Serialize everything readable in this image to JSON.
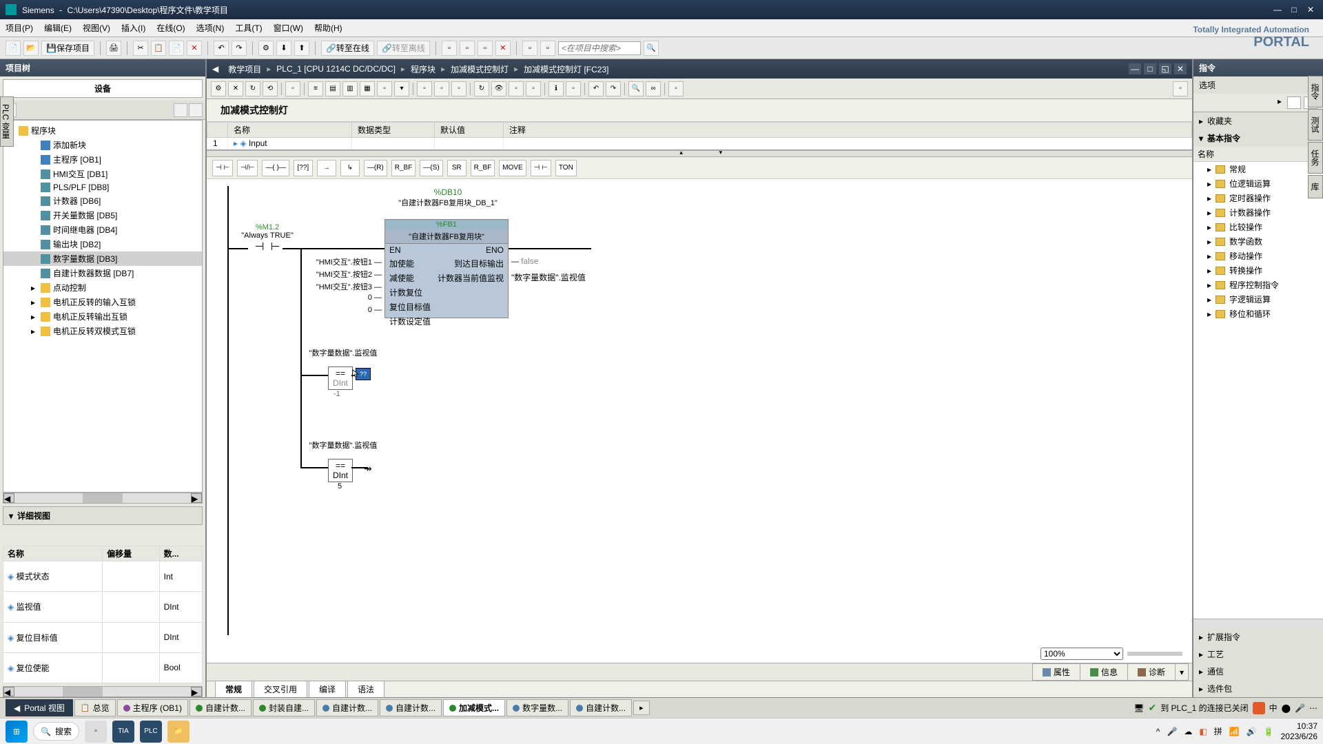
{
  "titlebar": {
    "app": "Siemens",
    "path": "C:\\Users\\47390\\Desktop\\程序文件\\教学项目"
  },
  "menu": [
    "项目(P)",
    "编辑(E)",
    "视图(V)",
    "插入(I)",
    "在线(O)",
    "选项(N)",
    "工具(T)",
    "窗口(W)",
    "帮助(H)"
  ],
  "brand": {
    "line1": "Totally Integrated Automation",
    "line2": "PORTAL"
  },
  "toolbar": {
    "save": "保存项目",
    "go_online": "转至在线",
    "go_offline": "转至离线",
    "search_placeholder": "<在项目中搜索>"
  },
  "breadcrumb": [
    "教学项目",
    "PLC_1 [CPU 1214C DC/DC/DC]",
    "程序块",
    "加减模式控制灯",
    "加减模式控制灯 [FC23]"
  ],
  "left": {
    "header": "项目树",
    "devices": "设备",
    "tree_root": "程序块",
    "tree": [
      {
        "label": "添加新块",
        "icon": "add"
      },
      {
        "label": "主程序 [OB1]",
        "icon": "ob"
      },
      {
        "label": "HMI交互 [DB1]",
        "icon": "db"
      },
      {
        "label": "PLS/PLF [DB8]",
        "icon": "db"
      },
      {
        "label": "计数器 [DB6]",
        "icon": "db"
      },
      {
        "label": "开关量数据 [DB5]",
        "icon": "db"
      },
      {
        "label": "时间继电器 [DB4]",
        "icon": "db"
      },
      {
        "label": "输出块 [DB2]",
        "icon": "db"
      },
      {
        "label": "数字量数据 [DB3]",
        "icon": "db",
        "selected": true
      },
      {
        "label": "自建计数器数据 [DB7]",
        "icon": "db"
      },
      {
        "label": "点动控制",
        "icon": "folder",
        "expandable": true
      },
      {
        "label": "电机正反转的输入互锁",
        "icon": "folder",
        "expandable": true
      },
      {
        "label": "电机正反转输出互锁",
        "icon": "folder",
        "expandable": true
      },
      {
        "label": "电机正反转双模式互锁",
        "icon": "folder",
        "expandable": true
      }
    ],
    "detail_header": "详细视图",
    "detail_cols": [
      "名称",
      "偏移量",
      "数..."
    ],
    "detail_rows": [
      {
        "name": "模式状态",
        "offset": "",
        "type": "Int"
      },
      {
        "name": "监视值",
        "offset": "",
        "type": "DInt"
      },
      {
        "name": "复位目标值",
        "offset": "",
        "type": "DInt"
      },
      {
        "name": "复位使能",
        "offset": "",
        "type": "Bool"
      }
    ]
  },
  "side_tab": "PLC 变量",
  "editor": {
    "block_title": "加减模式控制灯",
    "var_cols": [
      "",
      "名称",
      "数据类型",
      "默认值",
      "注释"
    ],
    "var_row_num": "1",
    "var_row_name": "Input",
    "lad_btns": [
      "⊣ ⊢",
      "⊣/⊢",
      "—( )—",
      "[??]",
      "→",
      "↳",
      "—(R)",
      "R_BF",
      "—(S)",
      "SR",
      "R_BF",
      "MOVE",
      "⊣ ⊢",
      "TON"
    ],
    "network": {
      "contact_tag": "%M1.2",
      "contact_name": "\"Always TRUE\"",
      "db_tag": "%DB10",
      "db_name": "\"自建计数器FB复用块_DB_1\"",
      "fb_tag": "%FB1",
      "fb_name": "\"自建计数器FB复用块\"",
      "fb_en": "EN",
      "fb_eno": "ENO",
      "fb_inputs": [
        {
          "src": "\"HMI交互\".按钮1",
          "pin": "加使能"
        },
        {
          "src": "\"HMI交互\".按钮2",
          "pin": "减使能"
        },
        {
          "src": "\"HMI交互\".按钮3",
          "pin": "计数复位"
        },
        {
          "src": "0",
          "pin": "复位目标值"
        },
        {
          "src": "0",
          "pin": "计数设定值"
        }
      ],
      "fb_outputs": [
        {
          "pin": "到达目标输出",
          "dst": "false"
        },
        {
          "pin": "计数器当前值监视",
          "dst": "\"数字量数据\".监视值"
        }
      ],
      "cmp1": {
        "src": "\"数字量数据\".监视值",
        "op": "==",
        "type": "DInt",
        "val": "-1"
      },
      "cmp2": {
        "src": "\"数字量数据\".监视值",
        "op": "==",
        "type": "DInt",
        "val": "5"
      }
    },
    "zoom": "100%"
  },
  "inspector_tabs": [
    "属性",
    "信息",
    "诊断"
  ],
  "bottom_tabs": [
    "常规",
    "交叉引用",
    "编译",
    "语法"
  ],
  "right": {
    "header": "指令",
    "options": "选项",
    "favorites": "收藏夹",
    "basic": "基本指令",
    "name_col": "名称",
    "items": [
      "常规",
      "位逻辑运算",
      "定时器操作",
      "计数器操作",
      "比较操作",
      "数学函数",
      "移动操作",
      "转换操作",
      "程序控制指令",
      "字逻辑运算",
      "移位和循环"
    ],
    "sections": [
      "扩展指令",
      "工艺",
      "通信",
      "选件包"
    ]
  },
  "editor_tabs": {
    "portal": "Portal 视图",
    "overview": "总览",
    "tabs": [
      {
        "label": "主程序 (OB1)",
        "color": "#8a4aa0"
      },
      {
        "label": "自建计数...",
        "color": "#2a8a2a"
      },
      {
        "label": "封装自建...",
        "color": "#2a8a2a"
      },
      {
        "label": "自建计数...",
        "color": "#4a7aaa"
      },
      {
        "label": "自建计数...",
        "color": "#4a7aaa"
      },
      {
        "label": "加减模式...",
        "color": "#2a8a2a",
        "active": true
      },
      {
        "label": "数字量数...",
        "color": "#4a7aaa"
      },
      {
        "label": "自建计数...",
        "color": "#4a7aaa"
      }
    ],
    "status": "到 PLC_1 的连接已关闭"
  },
  "taskbar": {
    "search": "搜索",
    "time": "10:37",
    "date": "2023/6/26"
  }
}
